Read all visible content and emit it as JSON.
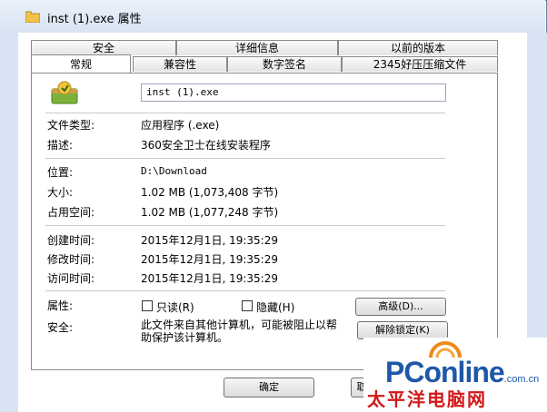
{
  "window": {
    "title": "inst (1).exe 属性"
  },
  "tabs_row1": [
    "安全",
    "详细信息",
    "以前的版本"
  ],
  "tabs_row2": [
    "常规",
    "兼容性",
    "数字签名",
    "2345好压压缩文件"
  ],
  "file_name": "inst (1).exe",
  "details": {
    "type_label": "文件类型:",
    "type_value": "应用程序 (.exe)",
    "desc_label": "描述:",
    "desc_value": "360安全卫士在线安装程序",
    "location_label": "位置:",
    "location_value": "D:\\Download",
    "size_label": "大小:",
    "size_value": "1.02 MB (1,073,408 字节)",
    "disk_label": "占用空间:",
    "disk_value": "1.02 MB (1,077,248 字节)",
    "created_label": "创建时间:",
    "created_value": "2015年12月1日, 19:35:29",
    "modified_label": "修改时间:",
    "modified_value": "2015年12月1日, 19:35:29",
    "accessed_label": "访问时间:",
    "accessed_value": "2015年12月1日, 19:35:29"
  },
  "attributes": {
    "label": "属性:",
    "readonly": "只读(R)",
    "hidden": "隐藏(H)",
    "advanced_button": "高级(D)..."
  },
  "security": {
    "label": "安全:",
    "message": "此文件来自其他计算机，可能被阻止以帮助保护该计算机。",
    "unblock_button": "解除锁定(K)"
  },
  "footer": {
    "ok_button": "确定",
    "cut_button": "取"
  },
  "watermark": {
    "brand": "PConline",
    "suffix": ".com.cn",
    "cn": "太平洋电脑网"
  }
}
